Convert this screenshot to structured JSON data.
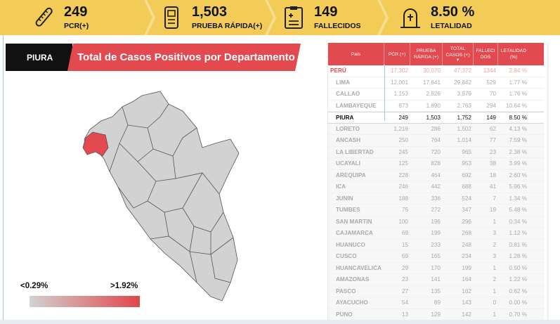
{
  "kpis": [
    {
      "value": "249",
      "label": "PCR(+)",
      "icon": "test-tube-icon"
    },
    {
      "value": "1,503",
      "label": "PRUEBA RÁPIDA(+)",
      "icon": "rapid-test-icon"
    },
    {
      "value": "149",
      "label": "FALLECIDOS",
      "icon": "clipboard-report-icon"
    },
    {
      "value": "8.50 %",
      "label": "LETALIDAD",
      "icon": "tombstone-icon"
    }
  ],
  "header": {
    "selected_department": "PIURA",
    "title": "Total de Casos Positivos por Departamento"
  },
  "legend": {
    "min": "<0.29%",
    "max": ">1.92%",
    "low_color": "#d2d2d2",
    "high_color": "#e0474c"
  },
  "colors": {
    "accent": "#e24a4f",
    "kpi_bg": "#f2cc57",
    "map_fill": "#d2d2d2",
    "map_highlight": "#e24a4f"
  },
  "table": {
    "columns": [
      "País",
      "PCR (+)",
      "PRUEBA RÁPIDA (+)",
      "TOTAL CASOS (+)",
      "FALLECI DOS",
      "LETALIDAD (%)"
    ],
    "sort_column": "TOTAL CASOS (+)",
    "rows": [
      {
        "name": "PERÚ",
        "pcr": "17,302",
        "rapida": "30,070",
        "total": "47,372",
        "fallecidos": "1344",
        "letalidad": "2.84 %",
        "type": "peru"
      },
      {
        "name": "LIMA",
        "pcr": "12,001",
        "rapida": "17,841",
        "total": "29,842",
        "fallecidos": "529",
        "letalidad": "1.77 %",
        "type": "normal"
      },
      {
        "name": "CALLAO",
        "pcr": "1,153",
        "rapida": "2,826",
        "total": "3,979",
        "fallecidos": "70",
        "letalidad": "1.76 %",
        "type": "normal"
      },
      {
        "name": "LAMBAYEQUE",
        "pcr": "873",
        "rapida": "1,890",
        "total": "2,763",
        "fallecidos": "294",
        "letalidad": "10.64 %",
        "type": "normal"
      },
      {
        "name": "PIURA",
        "pcr": "249",
        "rapida": "1,503",
        "total": "1,752",
        "fallecidos": "149",
        "letalidad": "8.50 %",
        "type": "sel"
      },
      {
        "name": "LORETO",
        "pcr": "1,216",
        "rapida": "286",
        "total": "1,502",
        "fallecidos": "62",
        "letalidad": "4.13 %",
        "type": "grey"
      },
      {
        "name": "ANCASH",
        "pcr": "250",
        "rapida": "764",
        "total": "1,014",
        "fallecidos": "77",
        "letalidad": "7.59 %",
        "type": "grey"
      },
      {
        "name": "LA LIBERTAD",
        "pcr": "245",
        "rapida": "720",
        "total": "965",
        "fallecidos": "23",
        "letalidad": "2.38 %",
        "type": "grey"
      },
      {
        "name": "UCAYALI",
        "pcr": "125",
        "rapida": "828",
        "total": "953",
        "fallecidos": "38",
        "letalidad": "3.99 %",
        "type": "grey"
      },
      {
        "name": "AREQUIPA",
        "pcr": "228",
        "rapida": "464",
        "total": "692",
        "fallecidos": "18",
        "letalidad": "2.60 %",
        "type": "grey"
      },
      {
        "name": "ICA",
        "pcr": "246",
        "rapida": "442",
        "total": "688",
        "fallecidos": "41",
        "letalidad": "5.96 %",
        "type": "grey"
      },
      {
        "name": "JUNIN",
        "pcr": "188",
        "rapida": "336",
        "total": "524",
        "fallecidos": "7",
        "letalidad": "1.34 %",
        "type": "grey"
      },
      {
        "name": "TUMBES",
        "pcr": "75",
        "rapida": "272",
        "total": "347",
        "fallecidos": "19",
        "letalidad": "5.48 %",
        "type": "grey"
      },
      {
        "name": "SAN MARTIN",
        "pcr": "100",
        "rapida": "196",
        "total": "296",
        "fallecidos": "1",
        "letalidad": "0.34 %",
        "type": "grey"
      },
      {
        "name": "CAJAMARCA",
        "pcr": "69",
        "rapida": "199",
        "total": "268",
        "fallecidos": "3",
        "letalidad": "1.12 %",
        "type": "grey"
      },
      {
        "name": "HUANUCO",
        "pcr": "15",
        "rapida": "233",
        "total": "248",
        "fallecidos": "2",
        "letalidad": "0.81 %",
        "type": "grey"
      },
      {
        "name": "CUSCO",
        "pcr": "69",
        "rapida": "165",
        "total": "234",
        "fallecidos": "3",
        "letalidad": "1.28 %",
        "type": "grey"
      },
      {
        "name": "HUANCAVELICA",
        "pcr": "29",
        "rapida": "170",
        "total": "199",
        "fallecidos": "1",
        "letalidad": "0.50 %",
        "type": "grey"
      },
      {
        "name": "AMAZONAS",
        "pcr": "23",
        "rapida": "141",
        "total": "164",
        "fallecidos": "2",
        "letalidad": "1.22 %",
        "type": "grey"
      },
      {
        "name": "PASCO",
        "pcr": "27",
        "rapida": "135",
        "total": "162",
        "fallecidos": "1",
        "letalidad": "0.62 %",
        "type": "grey"
      },
      {
        "name": "AYACUCHO",
        "pcr": "54",
        "rapida": "89",
        "total": "143",
        "fallecidos": "0",
        "letalidad": "0.00 %",
        "type": "grey"
      },
      {
        "name": "PUNO",
        "pcr": "13",
        "rapida": "129",
        "total": "142",
        "fallecidos": "1",
        "letalidad": "0.70 %",
        "type": "grey"
      }
    ]
  }
}
